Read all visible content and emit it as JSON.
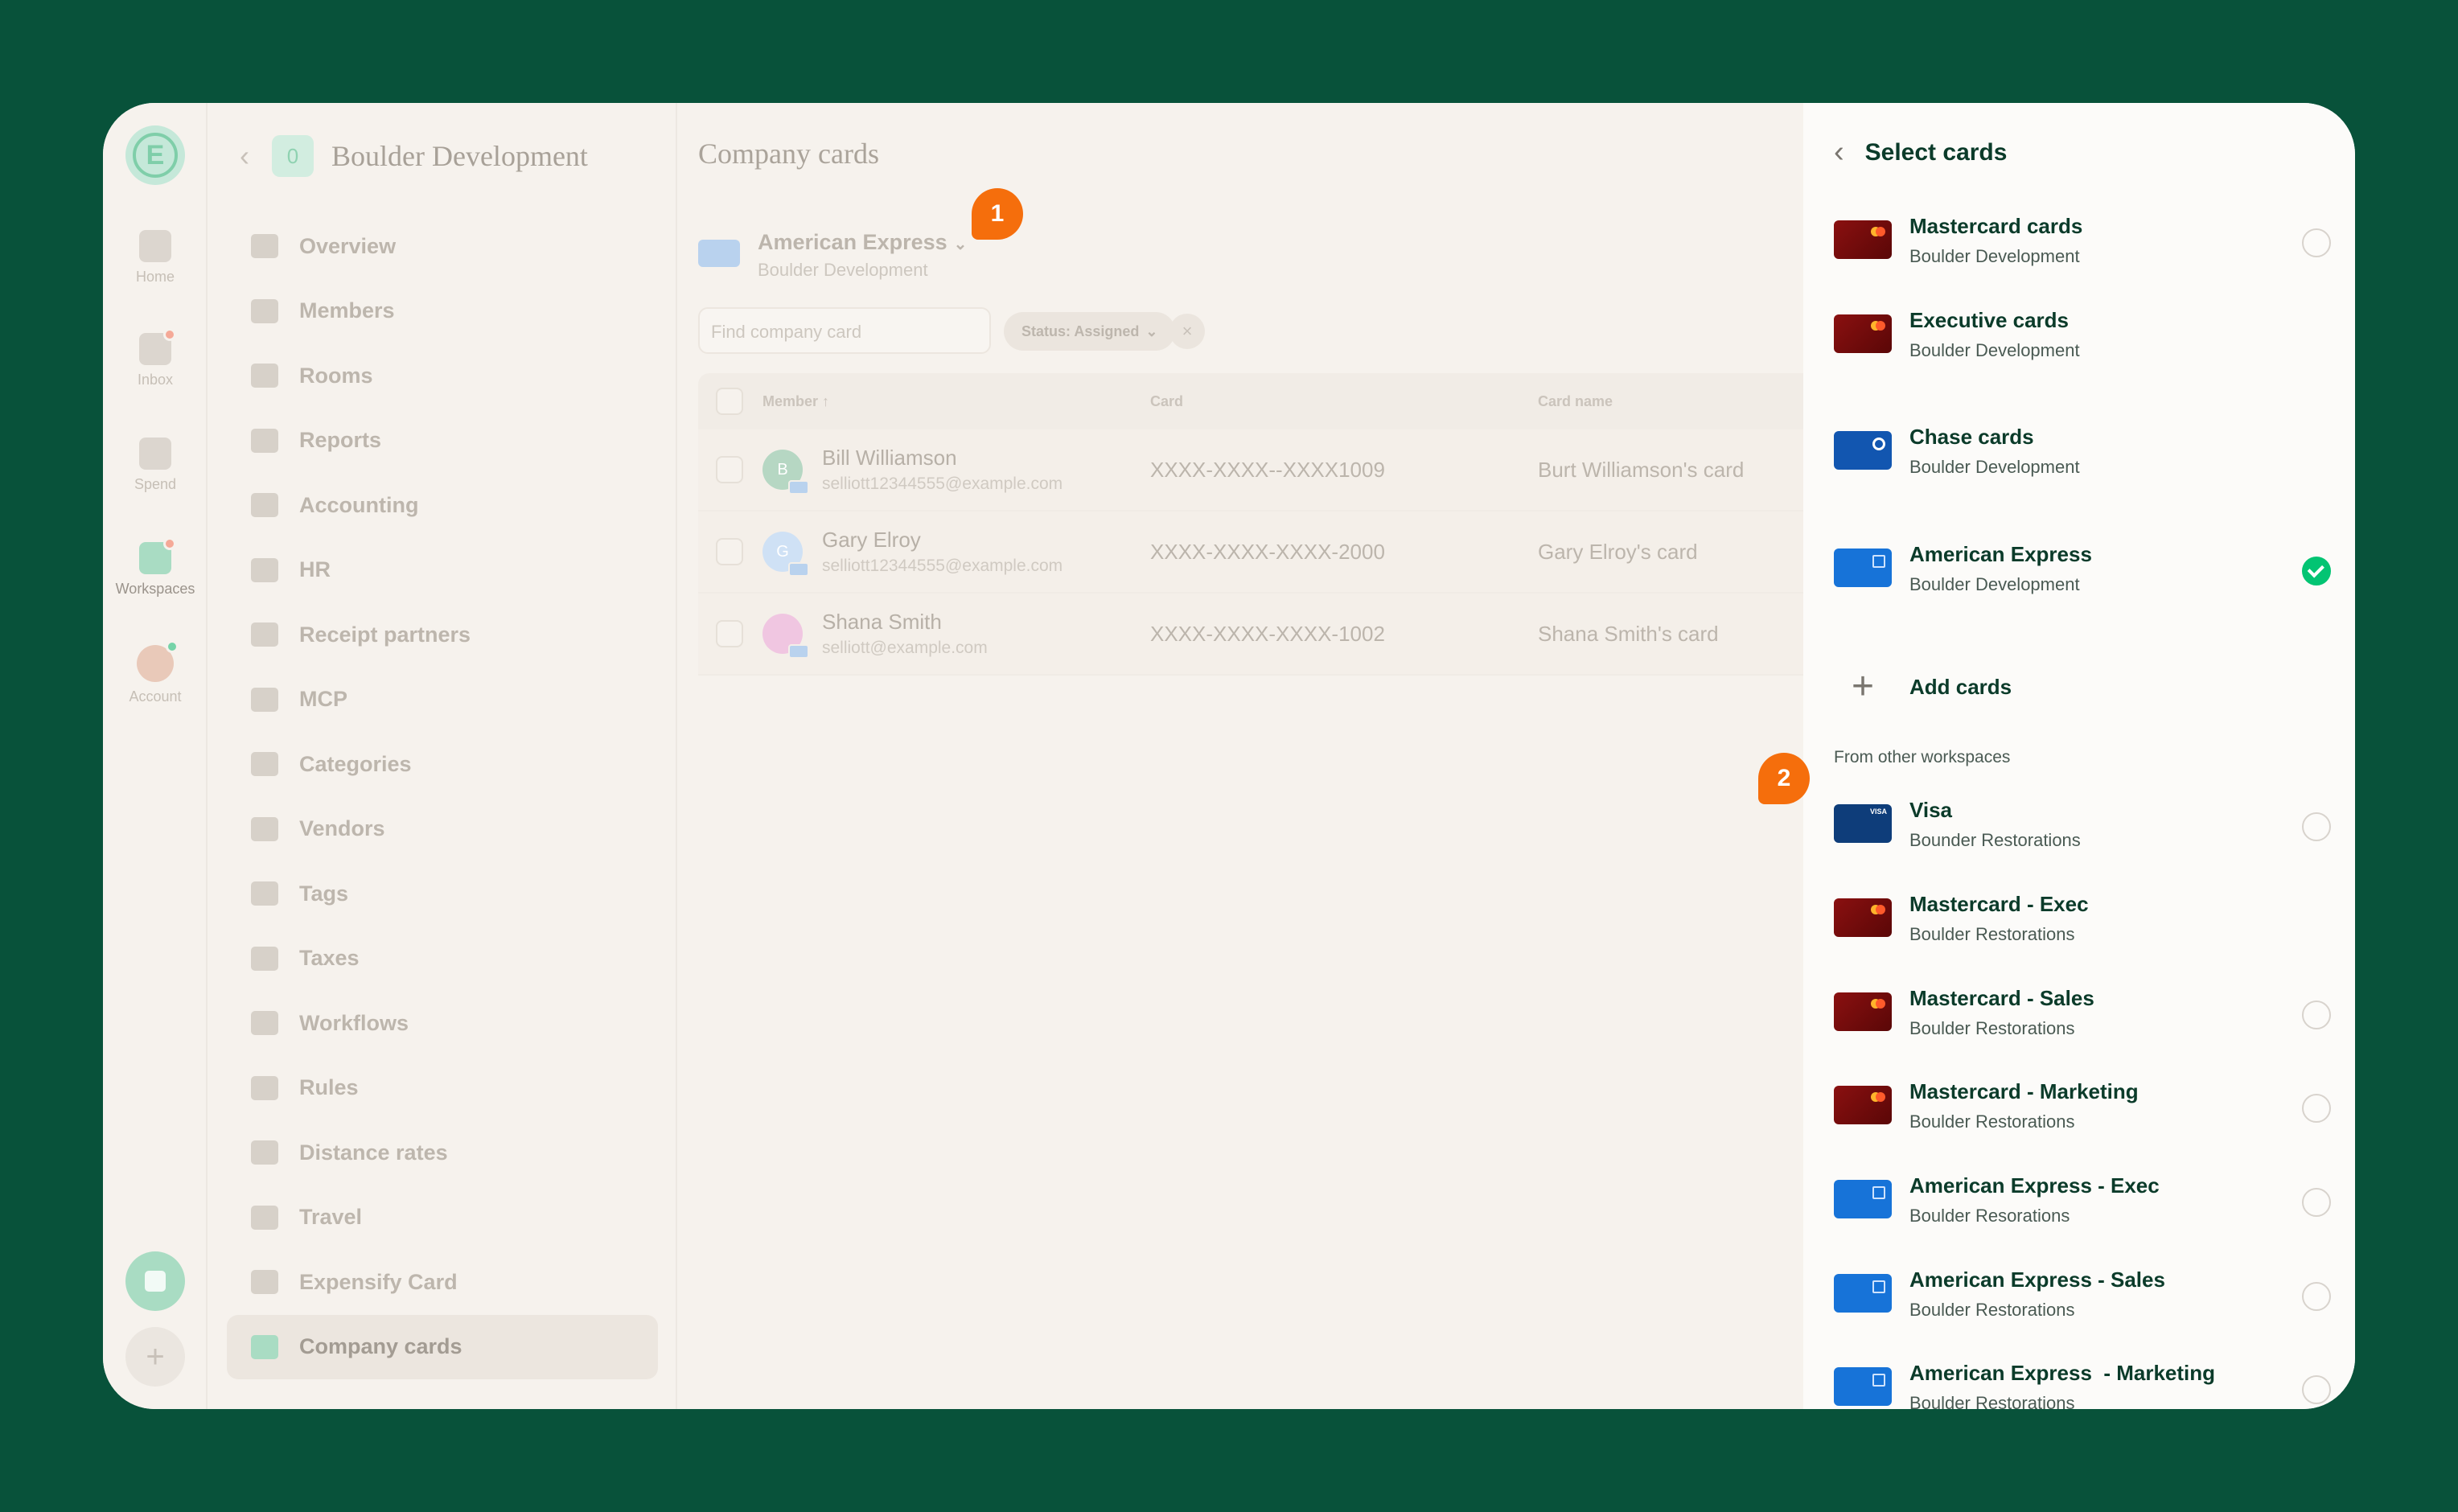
{
  "rail": {
    "items": [
      {
        "label": "Home",
        "icon": "home-icon"
      },
      {
        "label": "Inbox",
        "icon": "inbox-icon"
      },
      {
        "label": "Spend",
        "icon": "receipt-icon"
      },
      {
        "label": "Workspaces",
        "icon": "building-icon"
      },
      {
        "label": "Account",
        "icon": "avatar-icon"
      }
    ]
  },
  "nav": {
    "badge": "0",
    "title": "Boulder Development",
    "items": [
      "Overview",
      "Members",
      "Rooms",
      "Reports",
      "Accounting",
      "HR",
      "Receipt partners",
      "MCP",
      "Categories",
      "Vendors",
      "Tags",
      "Taxes",
      "Workflows",
      "Rules",
      "Distance rates",
      "Travel",
      "Expensify Card",
      "Company cards"
    ],
    "active": "Company cards"
  },
  "main": {
    "title": "Company cards",
    "feed_name": "American Express",
    "feed_sub": "Boulder Development",
    "search_placeholder": "Find company card",
    "filter_label": "Status: Assigned",
    "columns": [
      "Member",
      "Card",
      "Card name"
    ],
    "rows": [
      {
        "initial": "B",
        "name": "Bill Williamson",
        "email": "selliott12344555@example.com",
        "card": "XXXX-XXXX--XXXX1009",
        "card_name": "Burt Williamson's card",
        "avatar_color": "#b6d7c3"
      },
      {
        "initial": "G",
        "name": "Gary Elroy",
        "email": "selliott12344555@example.com",
        "card": "XXXX-XXXX-XXXX-2000",
        "card_name": "Gary Elroy's card",
        "avatar_color": "#cfe1f5"
      },
      {
        "initial": "",
        "name": "Shana Smith",
        "email": "selliott@example.com",
        "card": "XXXX-XXXX-XXXX-1002",
        "card_name": "Shana Smith's card",
        "avatar_color": "#f0c6e1"
      }
    ]
  },
  "panel": {
    "title": "Select cards",
    "cards": [
      {
        "name": "Mastercard cards",
        "sub": "Boulder Development",
        "type": "mc",
        "checked": false
      },
      {
        "name": "Executive cards",
        "sub": "Boulder Development",
        "type": "mc",
        "checked": false
      },
      {
        "name": "Chase cards",
        "sub": "Boulder Development",
        "type": "chase",
        "checked": false
      },
      {
        "name": "American Express",
        "sub": "Boulder Development",
        "type": "amex",
        "checked": true
      }
    ],
    "add_label": "Add cards",
    "section_label": "From other workspaces",
    "other_cards": [
      {
        "name": "Visa",
        "sub": "Bounder Restorations",
        "type": "visa",
        "checked": false
      },
      {
        "name": "Mastercard - Exec",
        "sub": "Boulder Restorations",
        "type": "mc",
        "checked": false
      },
      {
        "name": "Mastercard - Sales",
        "sub": "Boulder Restorations",
        "type": "mc",
        "checked": false
      },
      {
        "name": "Mastercard - Marketing",
        "sub": "Boulder Restorations",
        "type": "mc",
        "checked": false
      },
      {
        "name": "American Express - Exec",
        "sub": "Boulder Resorations",
        "type": "amex",
        "checked": false
      },
      {
        "name": "American Express - Sales",
        "sub": "Boulder Restorations",
        "type": "amex",
        "checked": false
      },
      {
        "name": "American Express  - Marketing",
        "sub": "Boulder Restorations",
        "type": "amex",
        "checked": false
      }
    ]
  },
  "callouts": [
    "1",
    "2"
  ],
  "colors": {
    "accent": "#03c473",
    "callout": "#f56e0c",
    "background": "#08523a"
  }
}
